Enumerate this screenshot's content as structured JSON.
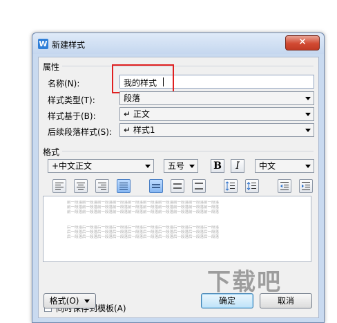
{
  "window": {
    "title": "新建样式",
    "close_glyph": "✕",
    "app_icon_letter": "W"
  },
  "properties": {
    "section_label": "属性",
    "name_label": "名称(N):",
    "name_value": "我的样式",
    "type_label": "样式类型(T):",
    "type_value": "段落",
    "based_on_label": "样式基于(B):",
    "based_on_value": "↵ 正文",
    "next_label": "后续段落样式(S):",
    "next_value": "↵ 样式1"
  },
  "format": {
    "section_label": "格式",
    "font_value": "+中文正文",
    "size_value": "五号",
    "bold_label": "B",
    "italic_label": "I",
    "language_value": "中文"
  },
  "preview": {
    "prev_line": "前一段落前一段落前一段落前一段落前一段落前一段落前一段落前一段落前一段落前一段落",
    "next_line": "后一段落后一段落后一段落后一段落后一段落后一段落后一段落后一段落后一段落后一段落"
  },
  "footer": {
    "template_checkbox_label": "同时保存到模板(A)",
    "template_checked": false,
    "format_button": "格式(O)",
    "ok_button": "确定",
    "cancel_button": "取消"
  },
  "watermark": {
    "text": "下载吧"
  },
  "colors": {
    "highlight": "#e02020",
    "active_button": "#86b7f2",
    "close_button": "#d24a33"
  }
}
